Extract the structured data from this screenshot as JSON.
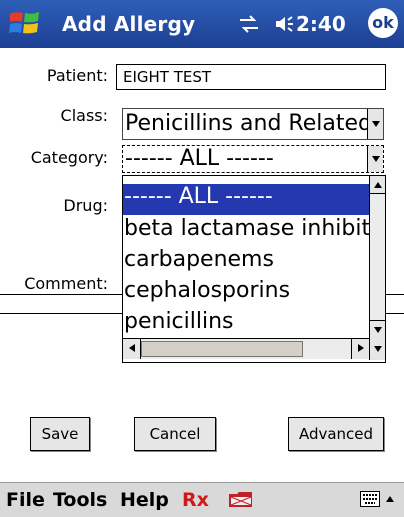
{
  "titlebar": {
    "title": "Add Allergy",
    "time": "2:40",
    "ok_label": "ok"
  },
  "form": {
    "patient_label": "Patient:",
    "patient_value": "EIGHT TEST",
    "class_label": "Class:",
    "class_value": "Penicillins and Related",
    "category_label": "Category:",
    "category_value": "------ ALL ------",
    "drug_label": "Drug:",
    "comment_label": "Comment:"
  },
  "dropdown": {
    "items": [
      "------ ALL ------",
      "beta lactamase inhibitors",
      "carbapenems",
      "cephalosporins",
      "penicillins"
    ],
    "selected_index": 0
  },
  "buttons": {
    "save": "Save",
    "cancel": "Cancel",
    "advanced": "Advanced"
  },
  "menubar": {
    "file": "File",
    "tools": "Tools",
    "help": "Help",
    "rx": "Rx"
  },
  "colors": {
    "titlebar": "#1c3f92",
    "selection": "#2438b0",
    "rx": "#d01818"
  }
}
